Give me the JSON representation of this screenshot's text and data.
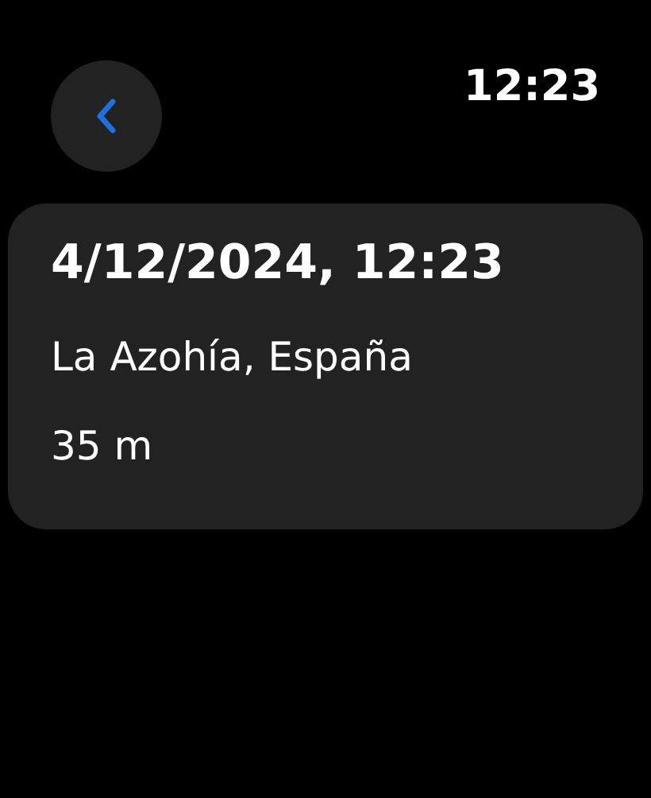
{
  "status_bar": {
    "time": "12:23"
  },
  "card": {
    "title": "4/12/2024, 12:23",
    "lines": [
      "La Azohía, España",
      "35 m"
    ]
  }
}
